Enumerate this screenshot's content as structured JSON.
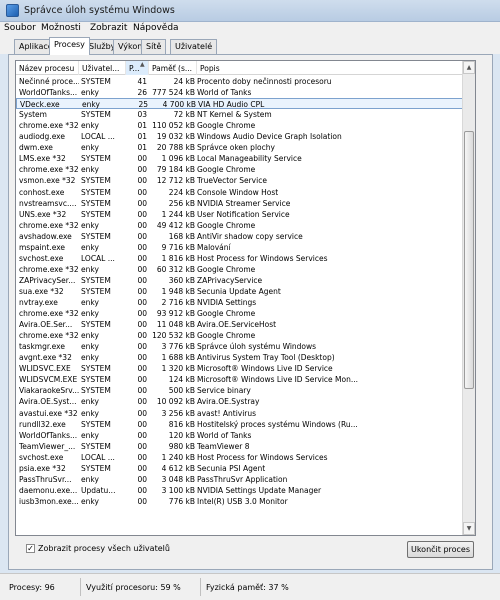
{
  "window": {
    "title": "Správce úloh systému Windows"
  },
  "menu": [
    "Soubor",
    "Možnosti",
    "Zobrazit",
    "Nápověda"
  ],
  "tabs": [
    "Aplikace",
    "Procesy",
    "Služby",
    "Výkon",
    "Sítě",
    "Uživatelé"
  ],
  "active_tab": "Procesy",
  "columns": [
    "Název procesu",
    "Uživatel...",
    "P...",
    "Paměť (s...",
    "Popis"
  ],
  "sorted_column": "P...",
  "processes": [
    [
      "Nečinné proce...",
      "SYSTEM",
      "41",
      "24 kB",
      "Procento doby nečinnosti procesoru"
    ],
    [
      "WorldOfTanks...",
      "enky",
      "26",
      "777 524 kB",
      "World of Tanks"
    ],
    [
      "VDeck.exe",
      "enky",
      "25",
      "4 700 kB",
      "VIA HD Audio CPL"
    ],
    [
      "System",
      "SYSTEM",
      "03",
      "72 kB",
      "NT Kernel & System"
    ],
    [
      "chrome.exe *32",
      "enky",
      "01",
      "110 052 kB",
      "Google Chrome"
    ],
    [
      "audiodg.exe",
      "LOCAL ...",
      "01",
      "19 032 kB",
      "Windows Audio Device Graph Isolation"
    ],
    [
      "dwm.exe",
      "enky",
      "01",
      "20 788 kB",
      "Správce oken plochy"
    ],
    [
      "LMS.exe *32",
      "SYSTEM",
      "00",
      "1 096 kB",
      "Local Manageability Service"
    ],
    [
      "chrome.exe *32",
      "enky",
      "00",
      "79 184 kB",
      "Google Chrome"
    ],
    [
      "vsmon.exe *32",
      "SYSTEM",
      "00",
      "12 712 kB",
      "TrueVector Service"
    ],
    [
      "conhost.exe",
      "SYSTEM",
      "00",
      "224 kB",
      "Console Window Host"
    ],
    [
      "nvstreamsvc....",
      "SYSTEM",
      "00",
      "256 kB",
      "NVIDIA Streamer Service"
    ],
    [
      "UNS.exe *32",
      "SYSTEM",
      "00",
      "1 244 kB",
      "User Notification Service"
    ],
    [
      "chrome.exe *32",
      "enky",
      "00",
      "49 412 kB",
      "Google Chrome"
    ],
    [
      "avshadow.exe",
      "SYSTEM",
      "00",
      "168 kB",
      "AntiVir shadow copy service"
    ],
    [
      "mspaint.exe",
      "enky",
      "00",
      "9 716 kB",
      "Malování"
    ],
    [
      "svchost.exe",
      "LOCAL ...",
      "00",
      "1 816 kB",
      "Host Process for Windows Services"
    ],
    [
      "chrome.exe *32",
      "enky",
      "00",
      "60 312 kB",
      "Google Chrome"
    ],
    [
      "ZAPrivacySer...",
      "SYSTEM",
      "00",
      "360 kB",
      "ZAPrivacyService"
    ],
    [
      "sua.exe *32",
      "SYSTEM",
      "00",
      "1 948 kB",
      "Secunia Update Agent"
    ],
    [
      "nvtray.exe",
      "enky",
      "00",
      "2 716 kB",
      "NVIDIA Settings"
    ],
    [
      "chrome.exe *32",
      "enky",
      "00",
      "93 912 kB",
      "Google Chrome"
    ],
    [
      "Avira.OE.Ser...",
      "SYSTEM",
      "00",
      "11 048 kB",
      "Avira.OE.ServiceHost"
    ],
    [
      "chrome.exe *32",
      "enky",
      "00",
      "120 532 kB",
      "Google Chrome"
    ],
    [
      "taskmgr.exe",
      "enky",
      "00",
      "3 776 kB",
      "Správce úloh systému Windows"
    ],
    [
      "avgnt.exe *32",
      "enky",
      "00",
      "1 688 kB",
      "Antivirus System Tray Tool (Desktop)"
    ],
    [
      "WLIDSVC.EXE",
      "SYSTEM",
      "00",
      "1 320 kB",
      "Microsoft® Windows Live ID Service"
    ],
    [
      "WLIDSVCM.EXE",
      "SYSTEM",
      "00",
      "124 kB",
      "Microsoft® Windows Live ID Service Mon..."
    ],
    [
      "ViakaraokeSrv...",
      "SYSTEM",
      "00",
      "500 kB",
      "Service binary"
    ],
    [
      "Avira.OE.Syst...",
      "enky",
      "00",
      "10 092 kB",
      "Avira.OE.Systray"
    ],
    [
      "avastui.exe *32",
      "enky",
      "00",
      "3 256 kB",
      "avast! Antivirus"
    ],
    [
      "rundll32.exe",
      "SYSTEM",
      "00",
      "816 kB",
      "Hostitelský proces systému Windows (Ru..."
    ],
    [
      "WorldOfTanks...",
      "enky",
      "00",
      "120 kB",
      "World of Tanks"
    ],
    [
      "TeamViewer_...",
      "SYSTEM",
      "00",
      "980 kB",
      "TeamViewer 8"
    ],
    [
      "svchost.exe",
      "LOCAL ...",
      "00",
      "1 240 kB",
      "Host Process for Windows Services"
    ],
    [
      "psia.exe *32",
      "SYSTEM",
      "00",
      "4 612 kB",
      "Secunia PSI Agent"
    ],
    [
      "PassThruSvr...",
      "enky",
      "00",
      "3 048 kB",
      "PassThruSvr Application"
    ],
    [
      "daemonu.exe...",
      "Updatu...",
      "00",
      "3 100 kB",
      "NVIDIA Settings Update Manager"
    ],
    [
      "iusb3mon.exe...",
      "enky",
      "00",
      "776 kB",
      "Intel(R) USB 3.0 Monitor"
    ]
  ],
  "selected_row": 2,
  "show_all_checkbox": {
    "label": "Zobrazit procesy všech uživatelů",
    "checked": true
  },
  "end_process_button": "Ukončit proces",
  "status": {
    "processes": "Procesy: 96",
    "cpu": "Využití procesoru: 59 %",
    "memory": "Fyzická paměť: 37 %"
  }
}
